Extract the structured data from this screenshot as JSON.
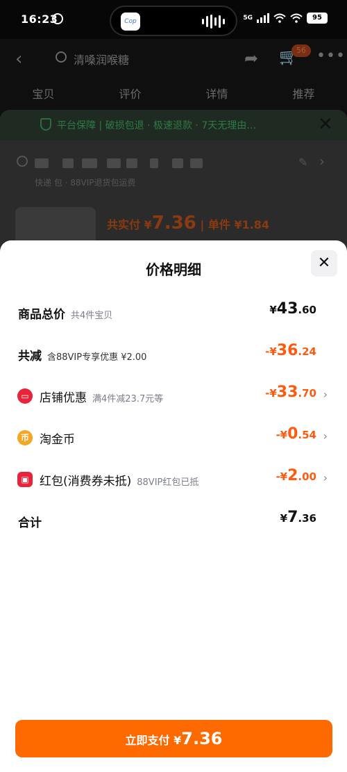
{
  "status_bar": {
    "time": "16:23",
    "island_app": "Cop",
    "network": "5G",
    "battery": "95"
  },
  "background_page": {
    "search_text": "清嗓润喉糖",
    "cart_badge": "56",
    "tabs": [
      "宝贝",
      "评价",
      "详情",
      "推荐"
    ],
    "banner_text": "平台保障 | 破损包退 · 极速退款 · 7天无理由…",
    "address_line2": "快递 包 · 88VIP退货包运费",
    "paid_label": "共实付 ¥",
    "paid_value": "7.36",
    "unit_price": "| 单件 ¥1.84"
  },
  "modal": {
    "title": "价格明细",
    "rows": [
      {
        "label": "商品总价",
        "note": "共4件宝贝",
        "amount_prefix": "¥",
        "amount_main": "43",
        "amount_dec": ".60"
      },
      {
        "label": "共减",
        "note": "含88VIP专享优惠 ¥2.00",
        "amount_prefix": "-¥",
        "amount_main": "36",
        "amount_dec": ".24"
      },
      {
        "label": "店铺优惠",
        "note": "满4件减23.7元等",
        "amount_prefix": "-¥",
        "amount_main": "33",
        "amount_dec": ".70"
      },
      {
        "label": "淘金币",
        "note": "",
        "amount_prefix": "-¥",
        "amount_main": "0",
        "amount_dec": ".54"
      },
      {
        "label": "红包(消费券未抵)",
        "note": "88VIP红包已抵",
        "amount_prefix": "-¥",
        "amount_main": "2",
        "amount_dec": ".00"
      },
      {
        "label": "合计",
        "note": "",
        "amount_prefix": "¥",
        "amount_main": "7",
        "amount_dec": ".36"
      }
    ],
    "pay_button": {
      "label": "立即支付 ¥",
      "price": "7.36"
    }
  },
  "colors": {
    "accent": "#ff6a00",
    "discount": "#ff5a0e",
    "shop_icon": "#e8233a",
    "coin_icon": "#f5a623",
    "redpacket_icon": "#e8233a"
  },
  "icons": {
    "shop": "shop-discount-icon",
    "coin": "taojin-coin-icon",
    "redpacket": "red-packet-icon"
  }
}
